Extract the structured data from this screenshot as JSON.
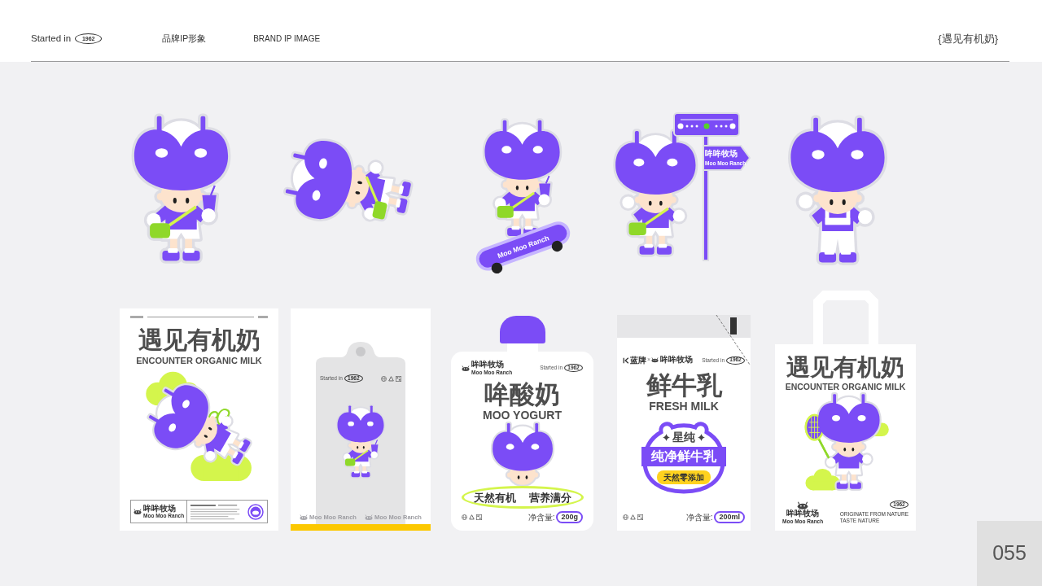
{
  "header": {
    "brand": {
      "prefix": "Started in",
      "year": "1962"
    },
    "nav": [
      {
        "label": "品牌IP形象"
      },
      {
        "label": "BRAND IP IMAGE"
      }
    ],
    "title": "{遇见有机奶}"
  },
  "characters": [
    {
      "kind": "cup"
    },
    {
      "kind": "lying"
    },
    {
      "kind": "skateboard",
      "board_label": "Moo Moo Ranch"
    },
    {
      "kind": "signpost",
      "sign_title": "哞哞牧场",
      "sign_subtitle": "Moo Moo Ranch"
    },
    {
      "kind": "overalls"
    }
  ],
  "products": [
    {
      "kind": "poster",
      "title": "遇见有机奶",
      "subtitle": "ENCOUNTER ORGANIC MILK",
      "logo": {
        "name": "哞哞牧场",
        "tagline": "Moo Moo Ranch"
      }
    },
    {
      "kind": "bag",
      "brand": {
        "prefix": "Started in",
        "year": "1962"
      },
      "watermarks": [
        "Moo Moo Ranch",
        "Moo Moo Ranch"
      ]
    },
    {
      "kind": "pouch",
      "logo": {
        "name": "哞哞牧场",
        "tagline": "Moo Moo Ranch"
      },
      "brand": {
        "prefix": "Started in",
        "year": "1962"
      },
      "title": "哞酸奶",
      "subtitle": "MOO YOGURT",
      "slogans": [
        "天然有机",
        "营养满分"
      ],
      "net_label": "净含量:",
      "net": "200g"
    },
    {
      "kind": "carton",
      "partner": "蓝牌",
      "separator": "×",
      "logo": {
        "name": "哞哞牧场"
      },
      "brand": {
        "prefix": "Started in",
        "year": "1962"
      },
      "title": "鲜牛乳",
      "subtitle": "FRESH MILK",
      "seal": {
        "top": "星纯",
        "band": "纯净鲜牛乳",
        "tag": "天然零添加"
      },
      "net_label": "净含量:",
      "net": "200ml"
    },
    {
      "kind": "tote",
      "title": "遇见有机奶",
      "subtitle": "ENCOUNTER ORGANIC MILK",
      "logo": {
        "name": "哞哞牧场",
        "tagline": "Moo Moo Ranch"
      },
      "year": "1962",
      "lines": [
        "ORIGINATE FROM NATURE",
        "TASTE NATURE"
      ]
    }
  ],
  "page_number": "055"
}
